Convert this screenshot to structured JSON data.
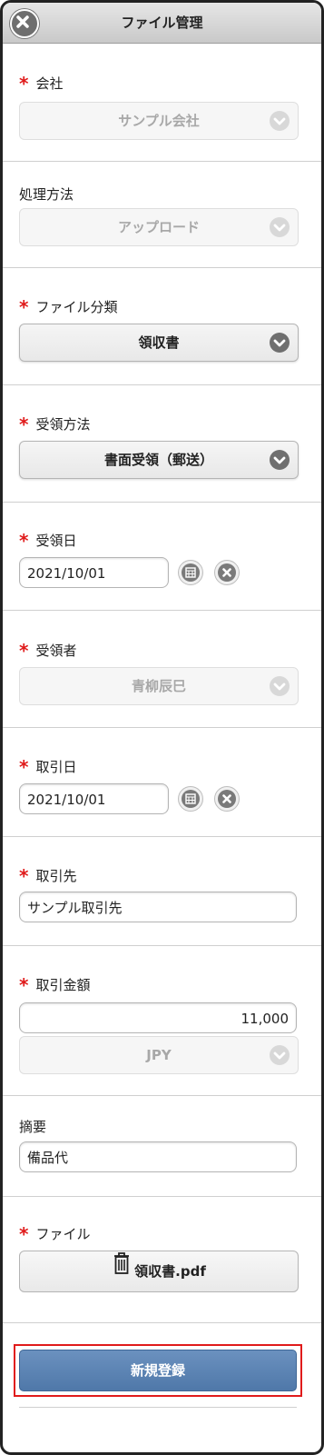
{
  "header": {
    "title": "ファイル管理"
  },
  "required_mark": "*",
  "fields": {
    "company": {
      "label": "会社",
      "value": "サンプル会社"
    },
    "process_method": {
      "label": "処理方法",
      "value": "アップロード"
    },
    "file_category": {
      "label": "ファイル分類",
      "value": "領収書"
    },
    "receipt_method": {
      "label": "受領方法",
      "value": "書面受領（郵送）"
    },
    "receipt_date": {
      "label": "受領日",
      "value": "2021/10/01"
    },
    "recipient": {
      "label": "受領者",
      "value": "青柳辰巳"
    },
    "transaction_date": {
      "label": "取引日",
      "value": "2021/10/01"
    },
    "business_partner": {
      "label": "取引先",
      "value": "サンプル取引先"
    },
    "amount": {
      "label": "取引金額",
      "value": "11,000",
      "currency": "JPY"
    },
    "memo": {
      "label": "摘要",
      "value": "備品代"
    },
    "file": {
      "label": "ファイル",
      "filename": "領収書.pdf"
    }
  },
  "submit": {
    "label": "新規登録"
  },
  "colors": {
    "required": "#e01b1b",
    "submit_bg": "#5b83b3",
    "highlight": "#e01b1b"
  }
}
